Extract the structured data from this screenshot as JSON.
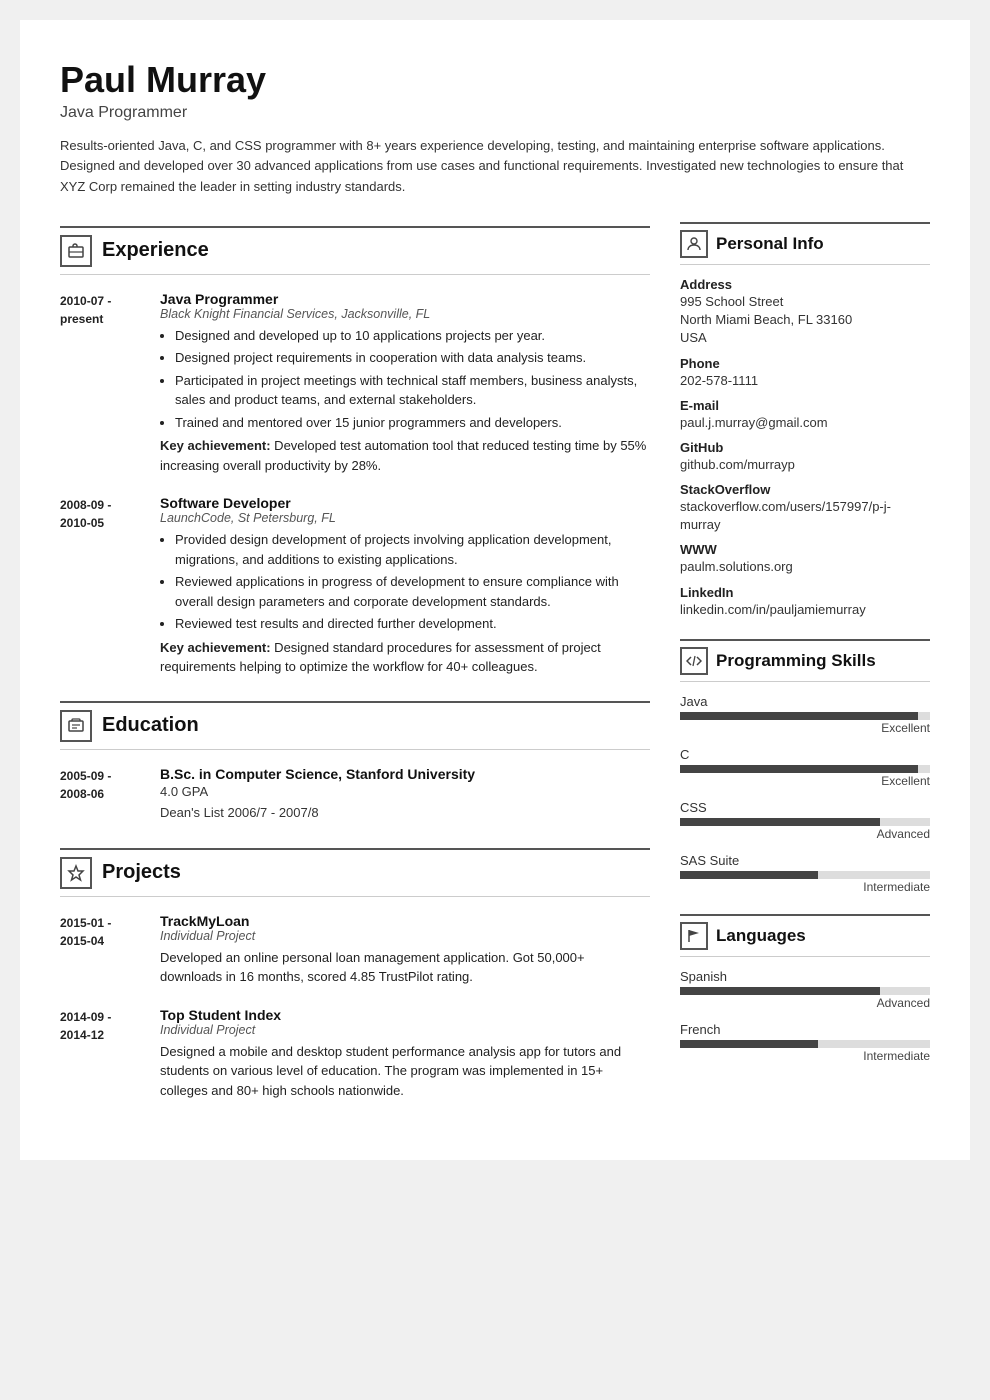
{
  "header": {
    "name": "Paul Murray",
    "title": "Java Programmer",
    "summary": "Results-oriented Java, C, and CSS programmer with 8+ years experience developing, testing, and maintaining enterprise software applications. Designed and developed over 30 advanced applications from use cases and functional requirements. Investigated new technologies to ensure that XYZ Corp remained the leader in setting industry standards."
  },
  "sections": {
    "experience": {
      "label": "Experience",
      "entries": [
        {
          "date": "2010-07 -\npresent",
          "title": "Java Programmer",
          "company": "Black Knight Financial Services, Jacksonville, FL",
          "bullets": [
            "Designed and developed up to 10 applications projects per year.",
            "Designed project requirements in cooperation with data analysis teams.",
            "Participated in project meetings with technical staff members, business analysts, sales and product teams, and external stakeholders.",
            "Trained and mentored over 15 junior programmers and developers."
          ],
          "achievement": "Developed test automation tool that reduced testing time by 55% increasing overall productivity by 28%."
        },
        {
          "date": "2008-09 -\n2010-05",
          "title": "Software Developer",
          "company": "LaunchCode, St Petersburg, FL",
          "bullets": [
            "Provided design development of projects involving application development, migrations, and additions to existing applications.",
            "Reviewed applications in progress of development to ensure compliance with overall design parameters and corporate development standards.",
            "Reviewed test results and directed further development."
          ],
          "achievement": "Designed standard procedures for assessment of project requirements helping to optimize the workflow for 40+ colleagues."
        }
      ]
    },
    "education": {
      "label": "Education",
      "entries": [
        {
          "date": "2005-09 -\n2008-06",
          "title": "B.Sc. in Computer Science, Stanford University",
          "details": [
            "4.0 GPA",
            "Dean's List 2006/7 - 2007/8"
          ]
        }
      ]
    },
    "projects": {
      "label": "Projects",
      "entries": [
        {
          "date": "2015-01 -\n2015-04",
          "title": "TrackMyLoan",
          "subtitle": "Individual Project",
          "description": "Developed an online personal loan management application. Got 50,000+ downloads in 16 months, scored 4.85 TrustPilot rating."
        },
        {
          "date": "2014-09 -\n2014-12",
          "title": "Top Student Index",
          "subtitle": "Individual Project",
          "description": "Designed a mobile and desktop student performance analysis app for tutors and students on various level of education. The program was implemented in 15+ colleges and 80+ high schools nationwide."
        }
      ]
    }
  },
  "sidebar": {
    "personal_info": {
      "label": "Personal Info",
      "fields": [
        {
          "label": "Address",
          "value": "995 School Street\nNorth Miami Beach, FL 33160\nUSA"
        },
        {
          "label": "Phone",
          "value": "202-578-1111"
        },
        {
          "label": "E-mail",
          "value": "paul.j.murray@gmail.com"
        },
        {
          "label": "GitHub",
          "value": "github.com/murrayp"
        },
        {
          "label": "StackOverflow",
          "value": "stackoverflow.com/users/157997/p-j-murray"
        },
        {
          "label": "WWW",
          "value": "paulm.solutions.org"
        },
        {
          "label": "LinkedIn",
          "value": "linkedin.com/in/pauljamiemurray"
        }
      ]
    },
    "programming_skills": {
      "label": "Programming Skills",
      "skills": [
        {
          "name": "Java",
          "level": "Excellent",
          "pct": 95
        },
        {
          "name": "C",
          "level": "Excellent",
          "pct": 95
        },
        {
          "name": "CSS",
          "level": "Advanced",
          "pct": 80
        },
        {
          "name": "SAS Suite",
          "level": "Intermediate",
          "pct": 55
        }
      ]
    },
    "languages": {
      "label": "Languages",
      "langs": [
        {
          "name": "Spanish",
          "level": "Advanced",
          "pct": 80
        },
        {
          "name": "French",
          "level": "Intermediate",
          "pct": 55
        }
      ]
    }
  }
}
